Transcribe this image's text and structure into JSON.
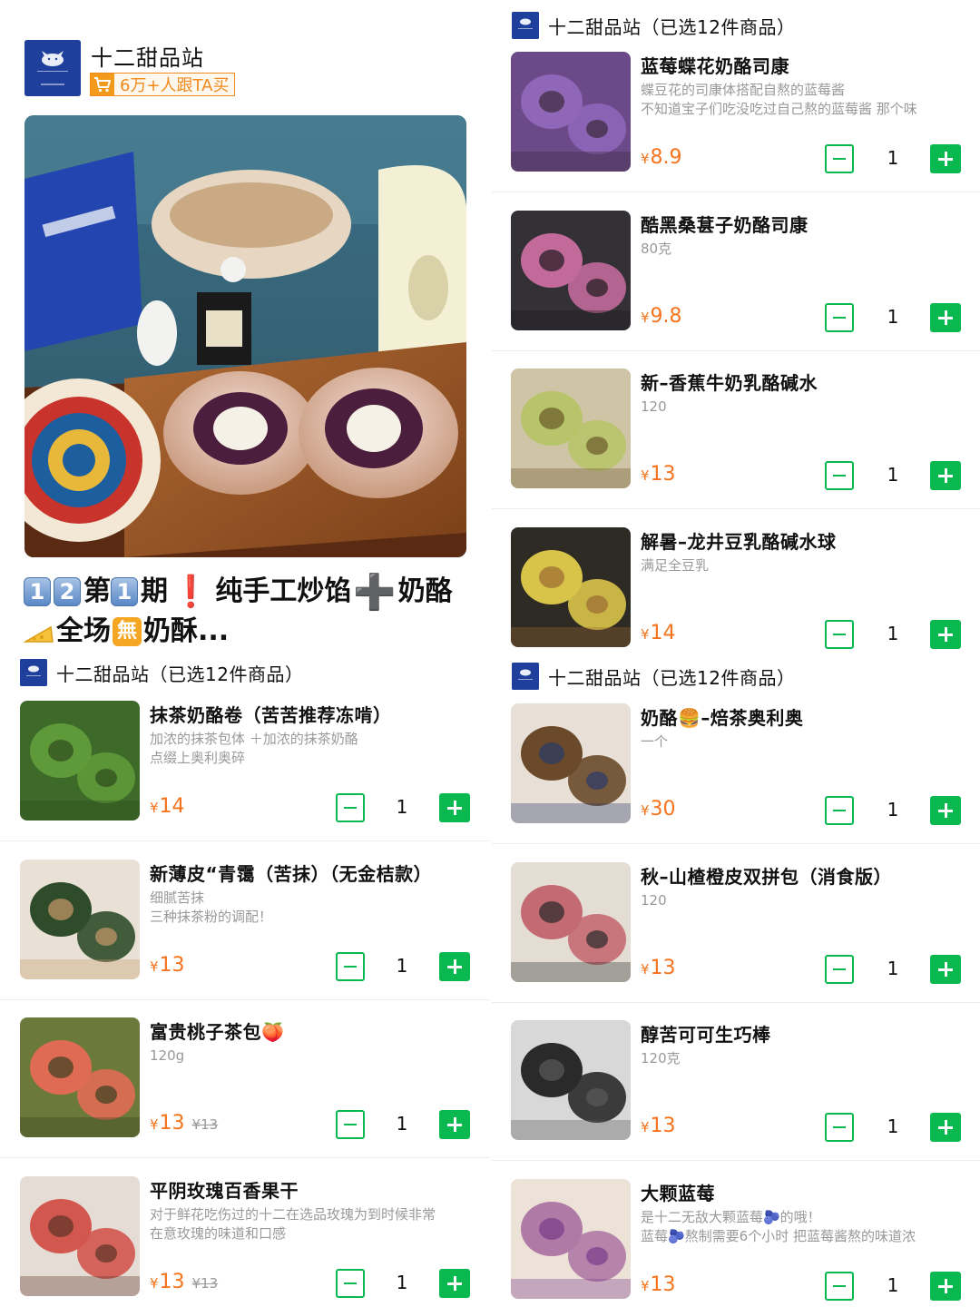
{
  "shop": {
    "name": "十二甜品站",
    "buyers_badge": "6万+人跟TA买",
    "logo_text": "十二手作"
  },
  "promo": {
    "digits": [
      "1",
      "2"
    ],
    "word1": "第",
    "issue": "1",
    "word2": "期",
    "bang": "❗",
    "text1": "纯手工炒馅",
    "plus": "➕",
    "text2": "奶酪",
    "text3": "全场",
    "free": "無",
    "text4": "奶酥..."
  },
  "store_bar_label": "十二甜品站（已选12件商品）",
  "left_items": [
    {
      "title": "抹茶奶酪卷（苦苦推荐冻啃）",
      "desc": [
        "加浓的抹茶包体 ＋加浓的抹茶奶酪",
        "点缀上奥利奥碎"
      ],
      "currency": "¥",
      "price": "14",
      "orig": "",
      "qty": "1"
    },
    {
      "title": "新薄皮“青霭（苦抹）（无金桔款）",
      "desc": [
        "细腻苦抹",
        "三种抹茶粉的调配！"
      ],
      "currency": "¥",
      "price": "13",
      "orig": "",
      "qty": "1"
    },
    {
      "title": "富贵桃子茶包🍑",
      "desc": [
        "120g"
      ],
      "currency": "¥",
      "price": "13",
      "orig": "¥13",
      "qty": "1"
    },
    {
      "title": "平阴玫瑰百香果干",
      "desc": [
        "对于鲜花吃伤过的十二在选品玫瑰为到时候非常",
        "在意玫瑰的味道和口感"
      ],
      "currency": "¥",
      "price": "13",
      "orig": "¥13",
      "qty": "1"
    }
  ],
  "right_items": [
    {
      "title": "蓝莓蝶花奶酪司康",
      "desc": [
        "蝶豆花的司康体搭配自熬的蓝莓酱",
        "不知道宝子们吃没吃过自己熬的蓝莓酱 那个味"
      ],
      "currency": "¥",
      "price": "8.9",
      "orig": "",
      "qty": "1"
    },
    {
      "title": "酷黑桑葚子奶酪司康",
      "desc": [
        "80克"
      ],
      "currency": "¥",
      "price": "9.8",
      "orig": "",
      "qty": "1"
    },
    {
      "title": "新–香蕉牛奶乳酪碱水",
      "desc": [
        "120"
      ],
      "currency": "¥",
      "price": "13",
      "orig": "",
      "qty": "1"
    },
    {
      "title": "解暑–龙井豆乳酪碱水球",
      "desc": [
        "满足全豆乳"
      ],
      "currency": "¥",
      "price": "14",
      "orig": "",
      "qty": "1"
    },
    {
      "title": "奶酪🍔–焙茶奥利奥",
      "desc": [
        "一个"
      ],
      "currency": "¥",
      "price": "30",
      "orig": "",
      "qty": "1"
    },
    {
      "title": "秋–山楂橙皮双拼包（消食版）",
      "desc": [
        "120"
      ],
      "currency": "¥",
      "price": "13",
      "orig": "",
      "qty": "1"
    },
    {
      "title": "醇苦可可生巧棒",
      "desc": [
        "120克"
      ],
      "currency": "¥",
      "price": "13",
      "orig": "",
      "qty": "1"
    },
    {
      "title": "大颗蓝莓",
      "desc": [
        "是十二无敌大颗蓝莓🫐的哦！",
        "蓝莓🫐熬制需要6个小时 把蓝莓酱熬的味道浓"
      ],
      "currency": "¥",
      "price": "13",
      "orig": "",
      "qty": "1"
    }
  ],
  "colors": {
    "accent_green": "#09b84e",
    "price_orange": "#f5731c",
    "badge_orange": "#f08a1c",
    "logo_blue": "#1f3f9c"
  },
  "icons": {
    "cart": "cart-icon",
    "minus": "minus-icon",
    "plus": "plus-icon"
  }
}
